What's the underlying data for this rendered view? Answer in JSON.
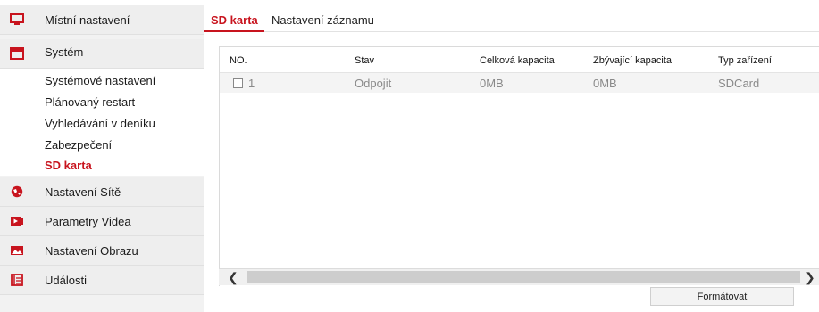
{
  "sidebar": {
    "items": [
      {
        "label": "Místní nastavení",
        "icon": "monitor-icon"
      },
      {
        "label": "Systém",
        "icon": "system-window-icon"
      },
      {
        "label": "Nastavení Sítě",
        "icon": "globe-icon"
      },
      {
        "label": "Parametry Videa",
        "icon": "video-icon"
      },
      {
        "label": "Nastavení Obrazu",
        "icon": "image-icon"
      },
      {
        "label": "Události",
        "icon": "events-icon"
      }
    ],
    "system_submenu": [
      {
        "label": "Systémové nastavení"
      },
      {
        "label": "Plánovaný restart"
      },
      {
        "label": "Vyhledávání v deníku"
      },
      {
        "label": "Zabezpečení"
      },
      {
        "label": "SD karta",
        "active": true
      }
    ]
  },
  "tabs": [
    {
      "label": "SD karta",
      "active": true
    },
    {
      "label": "Nastavení záznamu"
    }
  ],
  "table": {
    "headers": [
      "NO.",
      "Stav",
      "Celková kapacita",
      "Zbývající kapacita",
      "Typ zařízení"
    ],
    "rows": [
      {
        "no": "1",
        "stav": "Odpojit",
        "total": "0MB",
        "free": "0MB",
        "type": "SDCard"
      }
    ]
  },
  "actions": {
    "format_label": "Formátovat"
  },
  "colors": {
    "accent": "#c8141e",
    "sidebar_bg": "#f2f2f2",
    "header_bg": "#eeeeee"
  }
}
